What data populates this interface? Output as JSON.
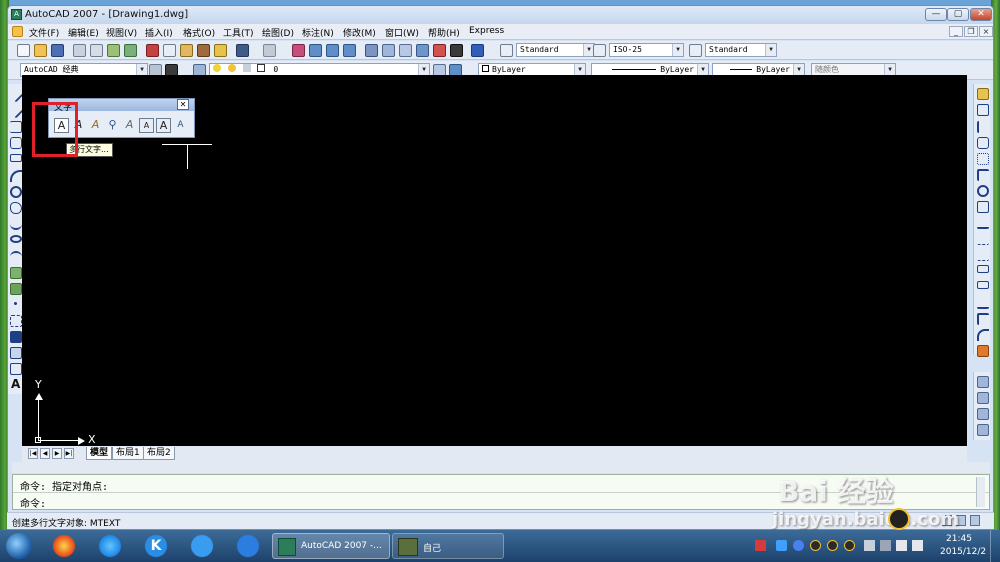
{
  "window": {
    "title": "AutoCAD 2007 - [Drawing1.dwg]",
    "app_icon_glyph": "A",
    "caption_minimize": "—",
    "caption_maximize": "▢",
    "caption_close": "✕",
    "mdi_minimize": "_",
    "mdi_restore": "❐",
    "mdi_close": "×"
  },
  "menu": [
    "文件(F)",
    "编辑(E)",
    "视图(V)",
    "插入(I)",
    "格式(O)",
    "工具(T)",
    "绘图(D)",
    "标注(N)",
    "修改(M)",
    "窗口(W)",
    "帮助(H)",
    "Express"
  ],
  "toolbar": {
    "text_style": "Standard",
    "dim_style": "ISO-25",
    "table_style": "Standard",
    "workspace": "AutoCAD 经典",
    "layer": "0",
    "color": "ByLayer",
    "linetype": "ByLayer",
    "lineweight": "ByLayer",
    "plotstyle": "随颜色"
  },
  "text_toolbar": {
    "title": "文字",
    "close_glyph": "✕",
    "buttons": [
      "A",
      "A",
      "A",
      "⚲",
      "A",
      "A",
      "A",
      "A"
    ]
  },
  "tooltip": "多行文字...",
  "canvas": {
    "y_axis_label": "Y",
    "x_axis_label": "X"
  },
  "tabs": {
    "nav": [
      "|◀",
      "◀",
      "▶",
      "▶|"
    ],
    "items": [
      "模型",
      "布局1",
      "布局2"
    ]
  },
  "command": {
    "line1": "命令: 指定对角点:",
    "line2": "命令:"
  },
  "status": {
    "text": "创建多行文字对象:  MTEXT"
  },
  "taskbar": {
    "window1": "AutoCAD 2007 -...",
    "window2": "自己",
    "time": "21:45",
    "date": "2015/12/2"
  },
  "watermark": {
    "brand": "Bai 经验",
    "url": "jingyan.baidu.com"
  },
  "colors": {
    "highlight": "#e0202a",
    "canvas": "#000000",
    "taskbar": "#2a557f"
  }
}
